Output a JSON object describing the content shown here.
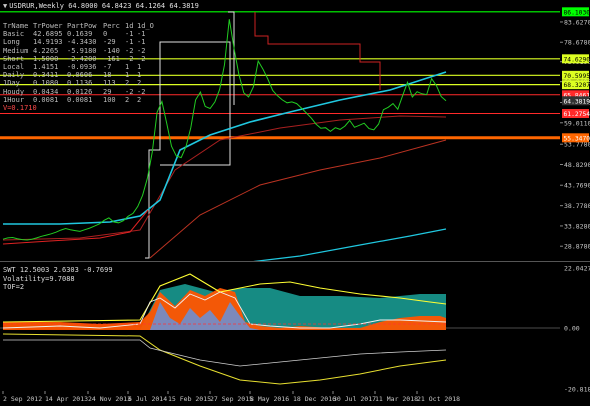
{
  "chart": {
    "title": "USDRUR,Weekly  64.8000 64.8423 64.1264 64.3819",
    "title_arrow": "▼",
    "stats_header": [
      "TrName",
      "TrPower",
      "PartPow",
      "Perc",
      "1d",
      "1d_O"
    ],
    "stats_rows": [
      [
        "Basic",
        "42.6895",
        "0.1639",
        "0",
        "-1",
        "-1"
      ],
      [
        "Long",
        "14.9193",
        "-4.3430",
        "-29",
        "-1",
        "-1"
      ],
      [
        "Medium",
        "4.2265",
        "-5.9180",
        "-140",
        "-2",
        "-2"
      ],
      [
        "Short",
        "1.5000",
        "-2.4200",
        "-161",
        "-2",
        "-2"
      ],
      [
        "Local",
        "1.4151",
        "-0.0936",
        "-7",
        "1",
        "1"
      ],
      [
        "Daily",
        "0.3411",
        "0.0606",
        "18",
        "1",
        "1"
      ],
      [
        "1Day",
        "0.1080",
        "0.1136",
        "113",
        "2",
        "2"
      ],
      [
        "Houdy",
        "0.0434",
        "0.0126",
        "29",
        "-2",
        "-2"
      ],
      [
        "1Hour",
        "0.0081",
        "0.0081",
        "100",
        "2",
        "2"
      ]
    ],
    "v_label": "V=0.1710",
    "y_ticks": [
      "83.6270",
      "78.6780",
      "73.9190",
      "69.0490",
      "63.9520",
      "59.0110",
      "53.7780",
      "48.8290",
      "43.7690",
      "38.7780",
      "33.8280",
      "28.8780"
    ],
    "level_badges": [
      {
        "value": "86.1030",
        "color": "#00ff00"
      },
      {
        "value": "74.6290",
        "color": "#ddff22"
      },
      {
        "value": "70.5995",
        "color": "#ddff22"
      },
      {
        "value": "68.3207",
        "color": "#ddff22"
      },
      {
        "value": "65.8461",
        "color": "#ff2a2a"
      },
      {
        "value": "64.3819",
        "color": "#333333"
      },
      {
        "value": "61.2754",
        "color": "#ff2a2a"
      },
      {
        "value": "55.3470",
        "color": "#ff6600"
      }
    ]
  },
  "indicator": {
    "info_line1": "SWT 12.5003 2.6303 -0.7699",
    "info_line2": "Volatility=9.7088",
    "info_line3": "TOF=2",
    "y_ticks": [
      "22.0427",
      "0.00",
      "-20.8181"
    ]
  },
  "x_axis": {
    "labels": [
      "2 Sep 2012",
      "14 Apr 2013",
      "24 Nov 2013",
      "6 Jul 2014",
      "15 Feb 2015",
      "27 Sep 2015",
      "8 May 2016",
      "18 Dec 2016",
      "30 Jul 2017",
      "11 Mar 2018",
      "21 Oct 2018"
    ]
  },
  "chart_data": {
    "type": "line",
    "title": "USDRUR,Weekly  64.8000 64.8423 64.1264 64.3819",
    "y_range": [
      26.0,
      88.5
    ],
    "x_ticks": [
      "2 Sep 2012",
      "14 Apr 2013",
      "24 Nov 2013",
      "6 Jul 2014",
      "15 Feb 2015",
      "27 Sep 2015",
      "8 May 2016",
      "18 Dec 2016",
      "30 Jul 2017",
      "11 Mar 2018",
      "21 Oct 2018"
    ],
    "y_ticks": [
      83.627,
      78.678,
      73.919,
      69.049,
      63.952,
      59.011,
      53.778,
      48.829,
      43.769,
      38.778,
      33.828,
      28.878
    ],
    "horizontal_levels": [
      86.103,
      74.629,
      70.5995,
      68.3207,
      65.8461,
      64.3819,
      61.2754,
      55.347
    ],
    "series": [
      {
        "color": "#22cc22",
        "values": [
          30.6,
          30.9,
          31.0,
          30.7,
          30.5,
          30.4,
          30.6,
          30.9,
          31.3,
          31.6,
          31.9,
          32.3,
          32.8,
          33.2,
          32.9,
          32.7,
          32.5,
          32.9,
          33.3,
          33.8,
          34.3,
          35.2,
          35.8,
          34.8,
          34.6,
          35.1,
          36.2,
          36.9,
          38.6,
          41.3,
          45.6,
          51.9,
          61.6,
          64.2,
          58.9,
          53.3,
          50.9,
          50.5,
          53.2,
          57.8,
          64.6,
          66.5,
          63.0,
          62.5,
          64.1,
          67.2,
          73.2,
          84.3,
          77.1,
          70.8,
          66.3,
          65.3,
          67.8,
          74.1,
          72.1,
          69.7,
          66.9,
          65.6,
          64.6,
          63.9,
          64.1,
          63.7,
          62.6,
          61.4,
          60.2,
          58.7,
          57.7,
          57.8,
          56.9,
          57.8,
          57.4,
          58.2,
          59.6,
          57.9,
          58.4,
          58.9,
          57.6,
          57.3,
          58.7,
          62.2,
          62.8,
          63.7,
          62.3,
          65.7,
          68.9,
          65.3,
          66.6,
          66.1,
          65.9,
          69.8,
          68.1,
          65.4,
          64.4
        ]
      }
    ]
  },
  "colors": {
    "price": "#22cc22",
    "ma_cyan": "#20c8e0",
    "ma_red": "#aa2020",
    "level_green": "#00ff00",
    "level_yellow": "#ddff22",
    "level_red": "#ff2a2a",
    "level_orange": "#ff6600",
    "fill_teal": "#1aa39a",
    "fill_orange": "#ff5500",
    "fill_blue": "#6f8fcf"
  }
}
